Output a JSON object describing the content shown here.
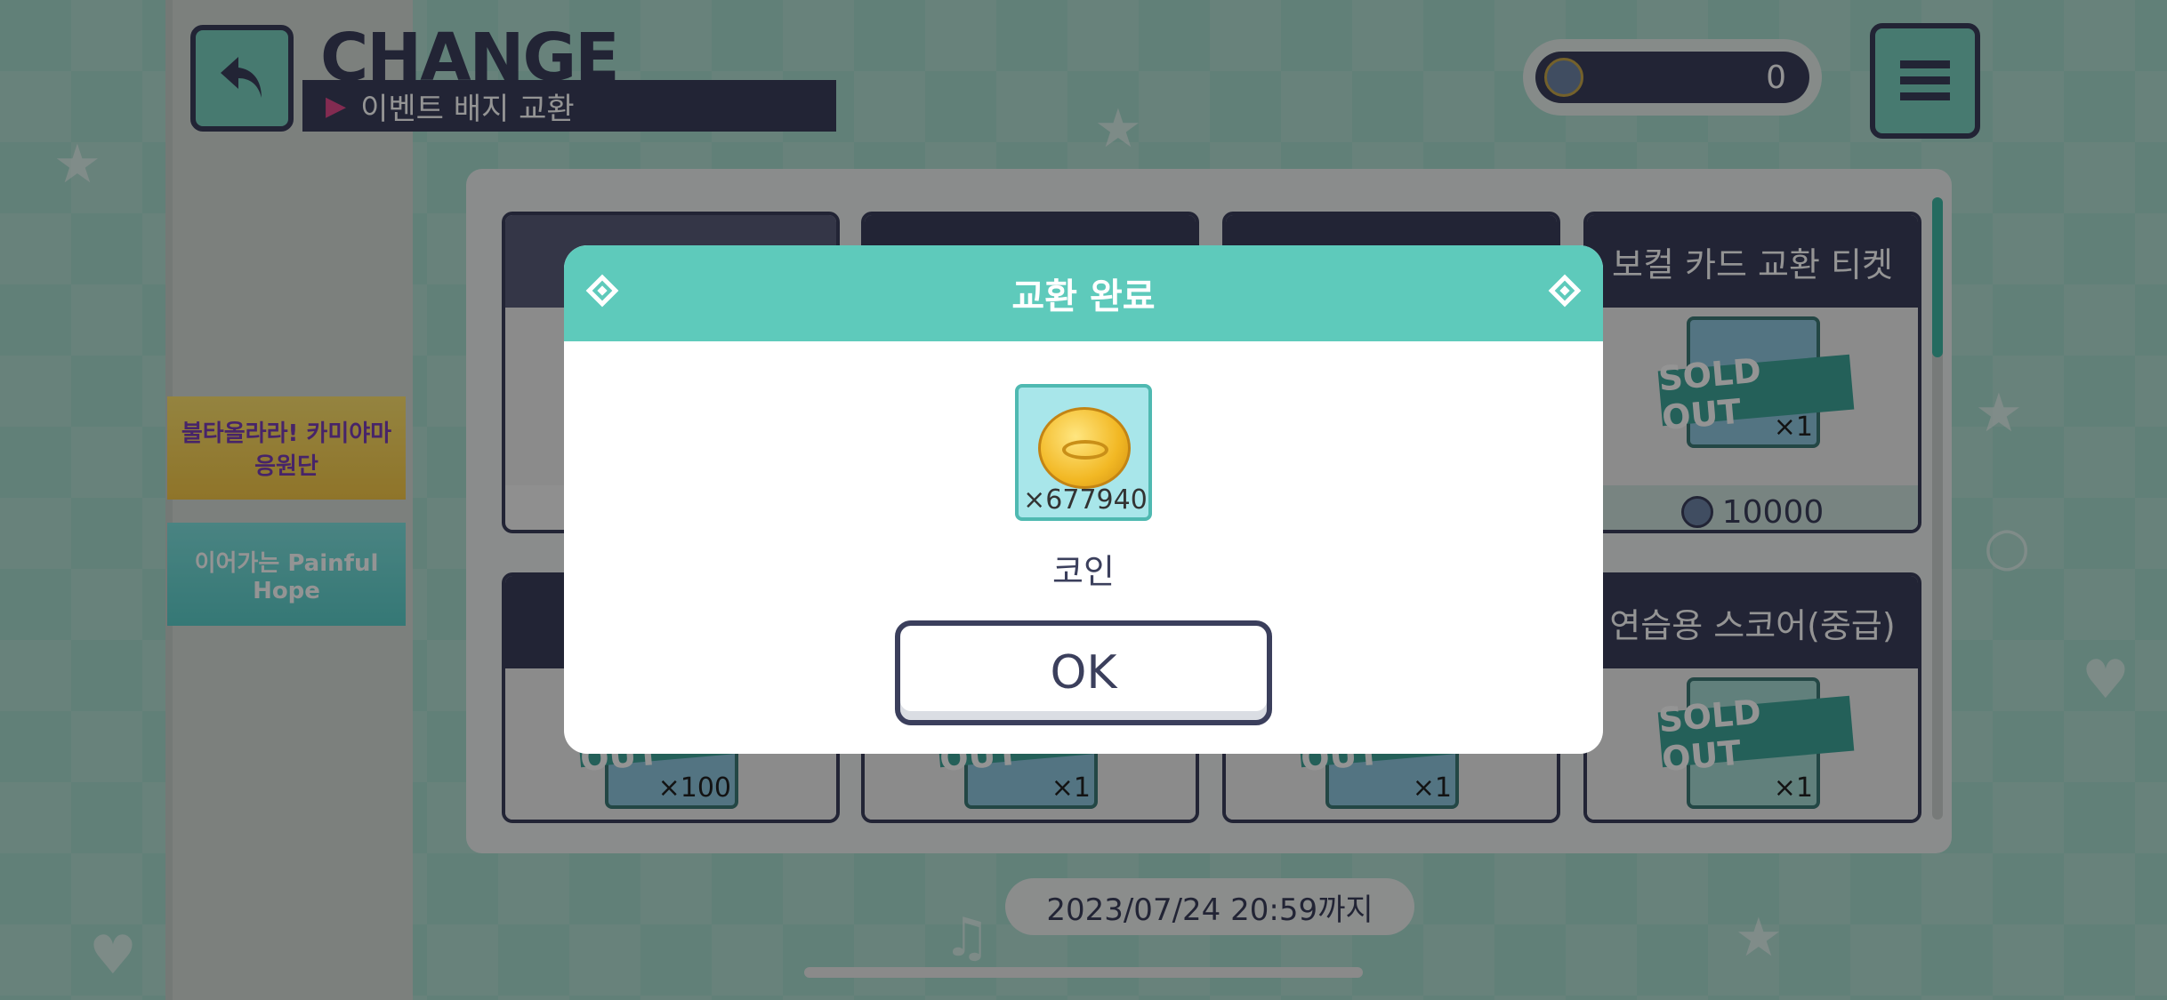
{
  "header": {
    "title": "CHANGE",
    "subtitle": "이벤트 배지 교환",
    "currency_value": "0",
    "currency_icon": "event-badge-icon"
  },
  "sidebar": {
    "banners": [
      {
        "label": "불타올라라! 카미야마 응원단"
      },
      {
        "label": "이어가는 Painful Hope"
      }
    ]
  },
  "shop": {
    "cards": [
      {
        "title": "",
        "sold_out": "",
        "qty": "",
        "price": ""
      },
      {
        "title": "",
        "sold_out": "",
        "qty": "",
        "price": ""
      },
      {
        "title": "",
        "sold_out": "",
        "qty": "",
        "price": ""
      },
      {
        "title": "보컬 카드 교환 티켓",
        "sold_out": "SOLD OUT",
        "qty": "×1",
        "price": "10000"
      },
      {
        "title": "",
        "sold_out": "SOLD OUT",
        "qty": "×100",
        "price": ""
      },
      {
        "title": "",
        "sold_out": "SOLD OUT",
        "qty": "×1",
        "price": ""
      },
      {
        "title": "",
        "sold_out": "SOLD OUT",
        "qty": "×1",
        "price": ""
      },
      {
        "title": "연습용 스코어(중급)",
        "sold_out": "SOLD OUT",
        "qty": "×1",
        "price": ""
      }
    ],
    "deadline": "2023/07/24 20:59까지"
  },
  "dialog": {
    "title": "교환 완료",
    "reward_qty": "×677940",
    "reward_name": "코인",
    "ok_label": "OK"
  },
  "colors": {
    "accent": "#5ecabb",
    "dark": "#3b3f5c",
    "sold_out": "#3fa59a"
  }
}
